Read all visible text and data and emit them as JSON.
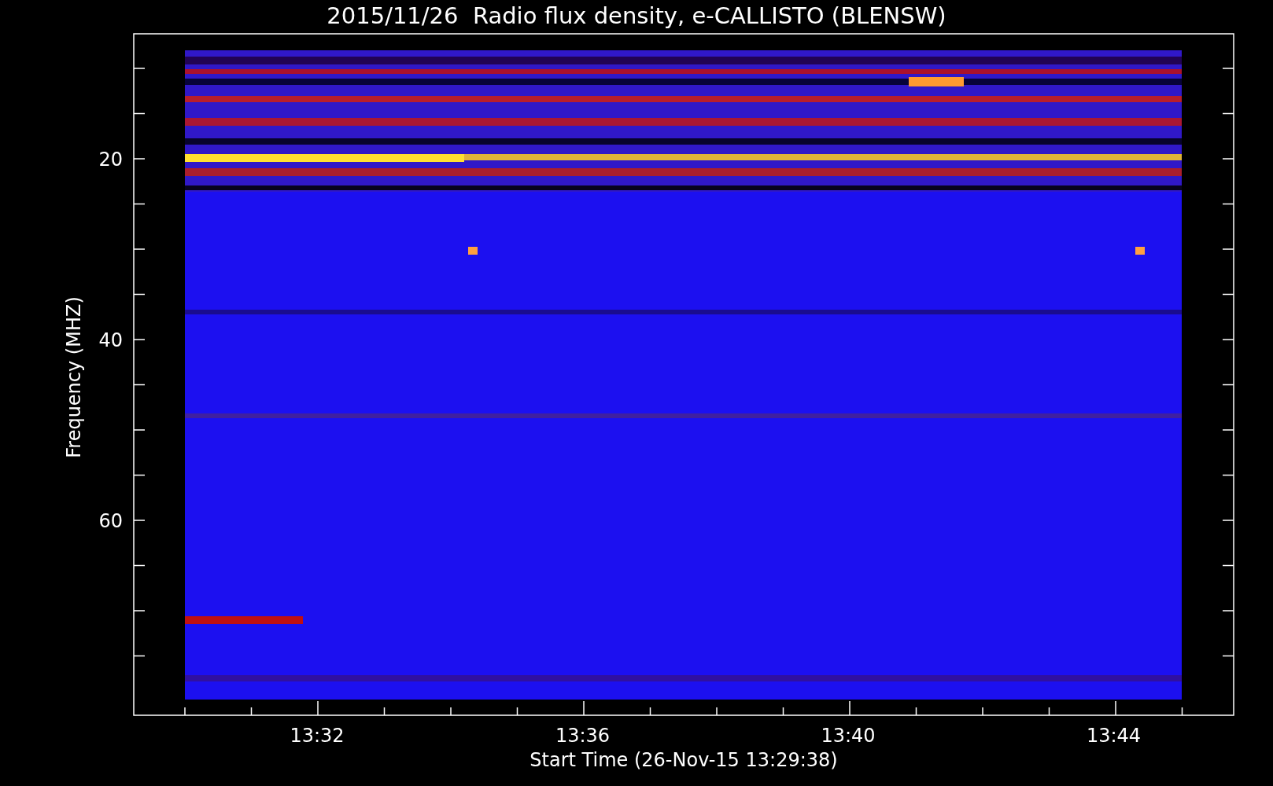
{
  "title": "2015/11/26  Radio flux density, e-CALLISTO (BLENSW)",
  "y_axis": {
    "label": "Frequency (MHZ)",
    "ticks": [
      "20",
      "40",
      "60"
    ]
  },
  "x_axis": {
    "label": "Start Time (26-Nov-15 13:29:38)",
    "ticks": [
      "13:32",
      "13:36",
      "13:40",
      "13:44"
    ]
  }
}
